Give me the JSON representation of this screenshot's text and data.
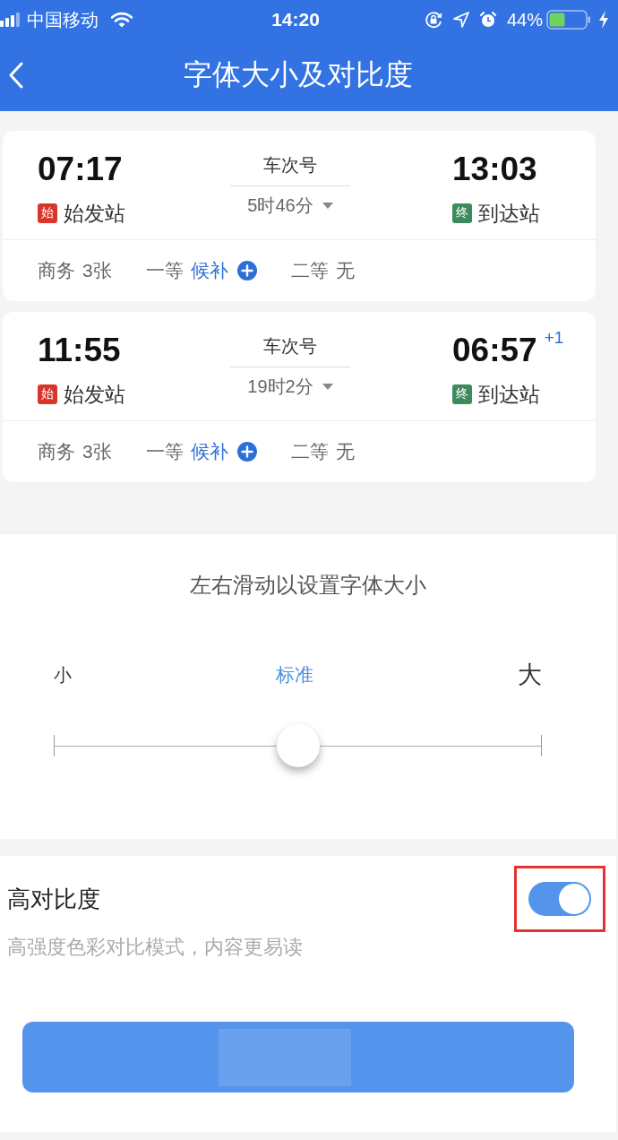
{
  "status_bar": {
    "carrier": "中国移动",
    "time": "14:20",
    "battery": "44%"
  },
  "header": {
    "title": "字体大小及对比度"
  },
  "trains": [
    {
      "depart_time": "07:17",
      "depart_badge": "始",
      "depart_station": "始发站",
      "train_no": "车次号",
      "duration": "5时46分",
      "arrive_time": "13:03",
      "arrive_badge": "终",
      "arrive_station": "到达站",
      "seats": [
        {
          "class": "商务",
          "status": "3张",
          "kind": "count"
        },
        {
          "class": "一等",
          "status": "候补",
          "kind": "waitlist"
        },
        {
          "class": "二等",
          "status": "无",
          "kind": "count"
        }
      ]
    },
    {
      "depart_time": "11:55",
      "depart_badge": "始",
      "depart_station": "始发站",
      "train_no": "车次号",
      "duration": "19时2分",
      "arrive_time": "06:57",
      "day_offset": "+1",
      "arrive_badge": "终",
      "arrive_station": "到达站",
      "seats": [
        {
          "class": "商务",
          "status": "3张",
          "kind": "count"
        },
        {
          "class": "一等",
          "status": "候补",
          "kind": "waitlist"
        },
        {
          "class": "二等",
          "status": "无",
          "kind": "count"
        }
      ]
    }
  ],
  "font_size": {
    "title": "左右滑动以设置字体大小",
    "options": [
      {
        "label": "小",
        "selected": false
      },
      {
        "label": "标准",
        "selected": true
      },
      {
        "label": "大",
        "selected": false
      }
    ],
    "level": 0.5
  },
  "contrast": {
    "title": "高对比度",
    "description": "高强度色彩对比模式，内容更易读",
    "on": true,
    "highlighted": true
  }
}
